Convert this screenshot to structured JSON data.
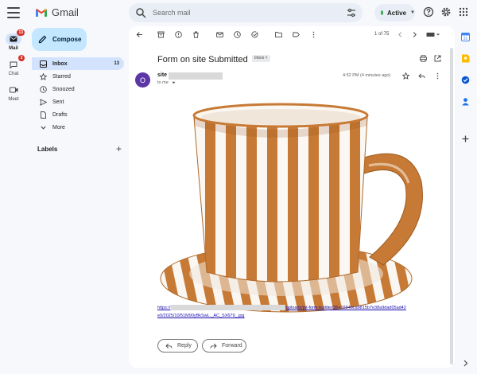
{
  "app": {
    "name": "Gmail"
  },
  "search": {
    "placeholder": "Search mail"
  },
  "status": {
    "label": "Active"
  },
  "rail": [
    {
      "label": "Mail",
      "badge": "13"
    },
    {
      "label": "Chat",
      "badge": "3"
    },
    {
      "label": "Meet"
    }
  ],
  "compose": {
    "label": "Compose"
  },
  "folders": [
    {
      "label": "Inbox",
      "count": "13",
      "icon": "inbox-icon"
    },
    {
      "label": "Starred",
      "icon": "star-icon"
    },
    {
      "label": "Snoozed",
      "icon": "clock-icon"
    },
    {
      "label": "Sent",
      "icon": "send-icon"
    },
    {
      "label": "Drafts",
      "icon": "draft-icon"
    },
    {
      "label": "More",
      "icon": "chevron-down-icon"
    }
  ],
  "labels": {
    "title": "Labels",
    "add": "+"
  },
  "toolbar": {
    "pager": "1 of 75"
  },
  "email": {
    "subject": "Form on site Submitted",
    "tag": "Inbox ×",
    "avatar_letter": "O",
    "sender": "site",
    "to": "to me",
    "timestamp": "4:52 PM (4 minutes ago)",
    "link_start": "https://",
    "link_tail": "/uploads/jet-form-builder/36a1694bca9815b7e38a9dad05ad42",
    "link_line2": "e0/2025/10/51M90yBkSwL._AC_SX679_.jpg",
    "reply": "Reply",
    "forward": "Forward"
  },
  "colors": {
    "accent": "#0b57d0",
    "compose_bg": "#c2e7ff",
    "active_bg": "#d3e3fd",
    "badge": "#d93025",
    "avatar": "#5c35a6",
    "cup_stripe": "#c77a35"
  }
}
